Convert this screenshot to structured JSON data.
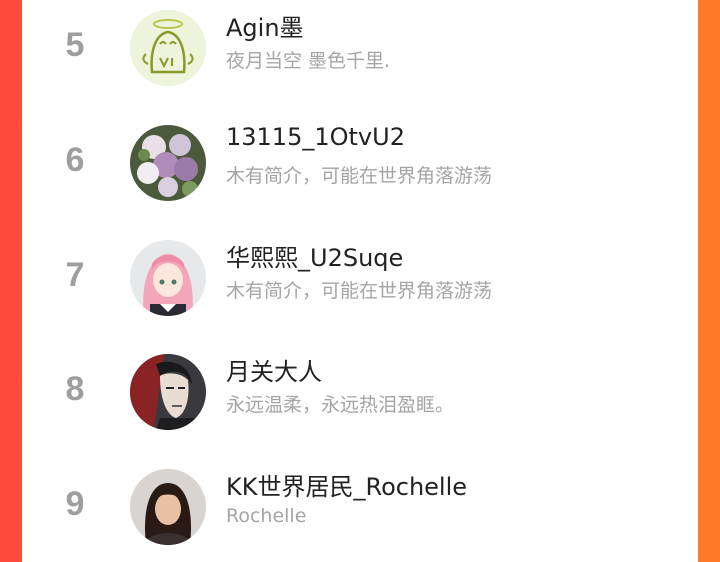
{
  "users": [
    {
      "rank": "5",
      "name": "Agin墨",
      "desc": "夜月当空 墨色千里.",
      "avatar": "angel-doodle-avatar"
    },
    {
      "rank": "6",
      "name": "13115_1OtvU2",
      "desc": "木有简介，可能在世界角落游荡",
      "avatar": "flower-bouquet-avatar"
    },
    {
      "rank": "7",
      "name": "华熙熙_U2Suqe",
      "desc": "木有简介，可能在世界角落游荡",
      "avatar": "anime-girl-avatar"
    },
    {
      "rank": "8",
      "name": "月关大人",
      "desc": "永远温柔，永远热泪盈眶。",
      "avatar": "anime-man-avatar"
    },
    {
      "rank": "9",
      "name": "KK世界居民_Rochelle",
      "desc": "Rochelle",
      "avatar": "woman-photo-avatar"
    }
  ]
}
